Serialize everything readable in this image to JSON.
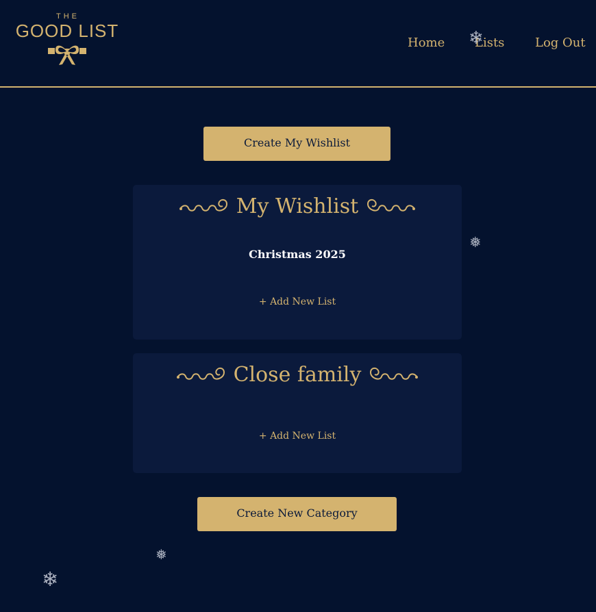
{
  "header": {
    "logo_the": "THE",
    "logo_main": "GOOD LIST",
    "nav": {
      "home": "Home",
      "lists": "Lists",
      "logout": "Log Out"
    }
  },
  "main": {
    "create_wishlist_label": "Create My Wishlist",
    "categories": [
      {
        "title": "My Wishlist",
        "lists": [
          "Christmas 2025"
        ],
        "add_label": "+ Add New List"
      },
      {
        "title": "Close family",
        "lists": [],
        "add_label": "+ Add New List"
      }
    ],
    "create_category_label": "Create New Category"
  },
  "decor": {
    "snowflake_glyph": "❄",
    "snowflake_small_glyph": "❅"
  },
  "colors": {
    "background": "#04122e",
    "card": "#0b1a3c",
    "accent_gold": "#d4b36f"
  }
}
